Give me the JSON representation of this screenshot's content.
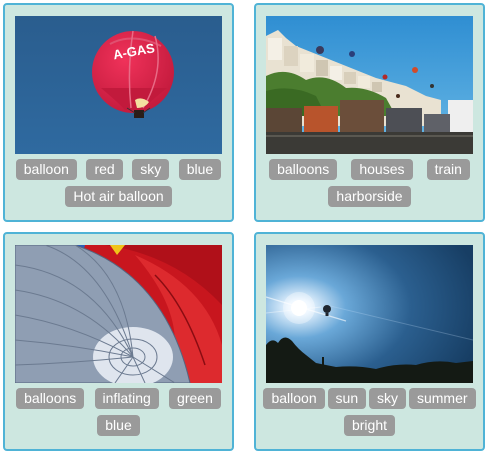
{
  "cards": [
    {
      "tags": [
        "balloon",
        "red",
        "sky",
        "blue",
        "Hot air balloon"
      ],
      "photo": "hot-air-balloon-red-sky"
    },
    {
      "tags": [
        "balloons",
        "houses",
        "train",
        "harborside"
      ],
      "photo": "harborside-train-balloons"
    },
    {
      "tags": [
        "balloons",
        "inflating",
        "green",
        "blue"
      ],
      "photo": "balloon-envelope-inflating"
    },
    {
      "tags": [
        "balloon",
        "sun",
        "sky",
        "summer",
        "bright"
      ],
      "photo": "sun-sky-balloon-silhouette"
    }
  ],
  "balloon_lettering": "A-GAS",
  "colors": {
    "card_background": "#cde7e0",
    "card_border": "#4fb3d6",
    "tag_background": "#9a9a9a",
    "tag_text": "#ffffff"
  }
}
